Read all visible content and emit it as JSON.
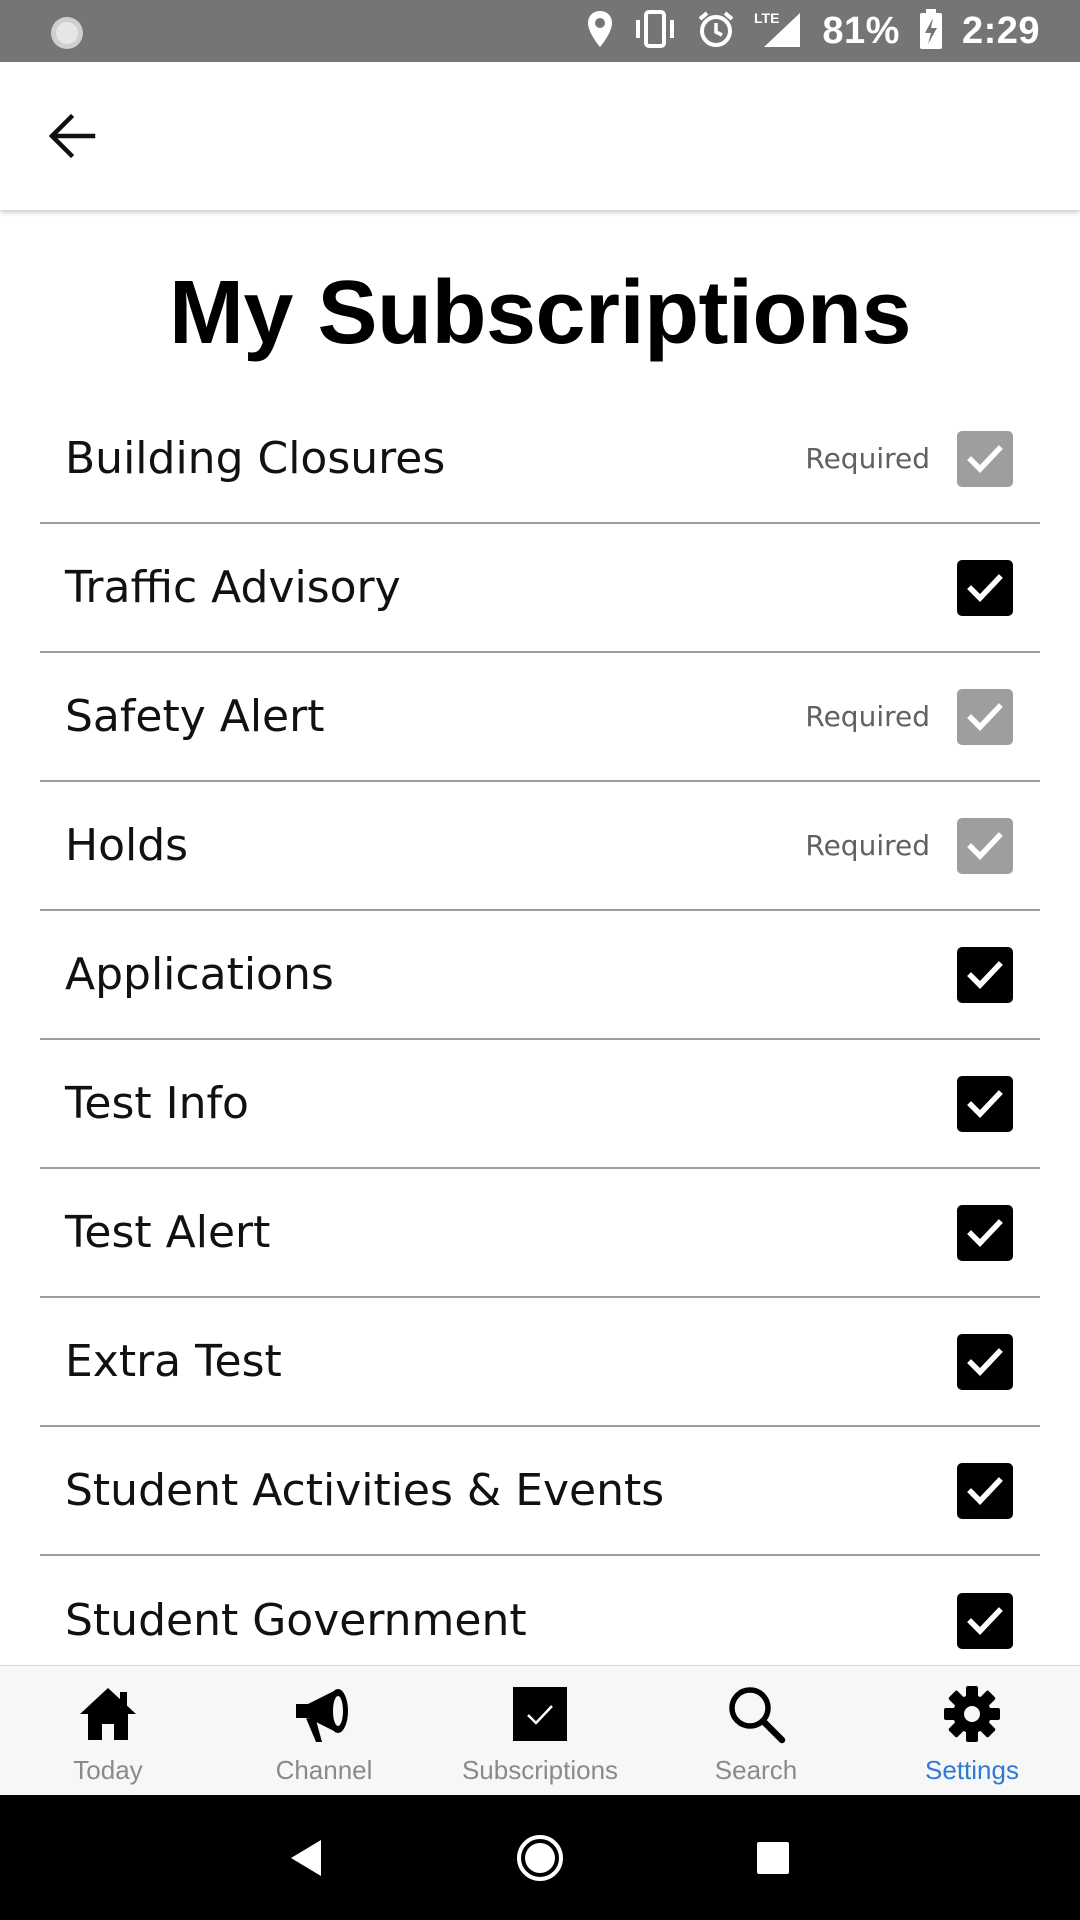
{
  "status_bar": {
    "battery": "81%",
    "time": "2:29",
    "network": "LTE"
  },
  "page": {
    "title": "My Subscriptions"
  },
  "subscriptions": [
    {
      "label": "Building Closures",
      "required_label": "Required",
      "checked": true,
      "required": true
    },
    {
      "label": "Traffic Advisory",
      "required_label": "",
      "checked": true,
      "required": false
    },
    {
      "label": "Safety Alert",
      "required_label": "Required",
      "checked": true,
      "required": true
    },
    {
      "label": "Holds",
      "required_label": "Required",
      "checked": true,
      "required": true
    },
    {
      "label": "Applications",
      "required_label": "",
      "checked": true,
      "required": false
    },
    {
      "label": "Test Info",
      "required_label": "",
      "checked": true,
      "required": false
    },
    {
      "label": "Test Alert",
      "required_label": "",
      "checked": true,
      "required": false
    },
    {
      "label": "Extra Test",
      "required_label": "",
      "checked": true,
      "required": false
    },
    {
      "label": "Student Activities & Events",
      "required_label": "",
      "checked": true,
      "required": false
    },
    {
      "label": "Student Government",
      "required_label": "",
      "checked": true,
      "required": false
    }
  ],
  "bottom_nav": {
    "items": [
      {
        "label": "Today",
        "icon": "home-icon",
        "active": false
      },
      {
        "label": "Channel",
        "icon": "megaphone-icon",
        "active": false
      },
      {
        "label": "Subscriptions",
        "icon": "checkbox-icon",
        "active": false
      },
      {
        "label": "Search",
        "icon": "search-icon",
        "active": false
      },
      {
        "label": "Settings",
        "icon": "gear-icon",
        "active": true
      }
    ]
  },
  "colors": {
    "status_bar_bg": "#757575",
    "checked_box": "#000000",
    "required_box": "#9e9e9e",
    "nav_active": "#2d7bd6",
    "nav_inactive": "#8a8a8a"
  }
}
